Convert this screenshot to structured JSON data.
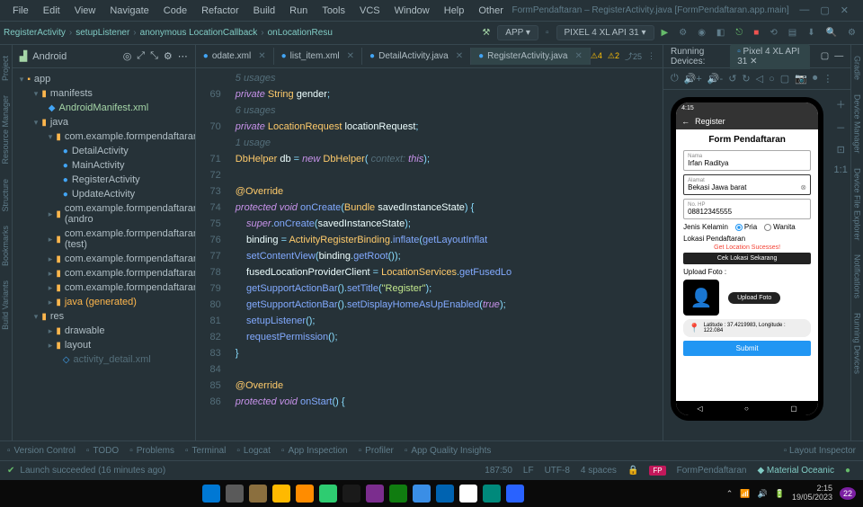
{
  "menu": [
    "File",
    "Edit",
    "View",
    "Navigate",
    "Code",
    "Refactor",
    "Build",
    "Run",
    "Tools",
    "VCS",
    "Window",
    "Help",
    "Other"
  ],
  "window_title": "FormPendaftaran – RegisterActivity.java [FormPendaftaran.app.main]",
  "breadcrumb": [
    "RegisterActivity",
    "setupListener",
    "anonymous LocationCallback",
    "onLocationResu"
  ],
  "run_config": "APP",
  "device_combo": "PIXEL 4 XL API 31",
  "project_label": "Android",
  "tree": {
    "app": "app",
    "manifests": "manifests",
    "manifest_file": "AndroidManifest.xml",
    "java": "java",
    "pkg": "com.example.formpendaftaran",
    "files": [
      "DetailActivity",
      "MainActivity",
      "RegisterActivity",
      "UpdateActivity"
    ],
    "other_pkgs": [
      "com.example.formpendaftaran (andro",
      "com.example.formpendaftaran (test)",
      "com.example.formpendaftaran.adapto",
      "com.example.formpendaftaran.db",
      "com.example.formpendaftaran.model"
    ],
    "gen": "java (generated)",
    "res": "res",
    "res_sub": [
      "drawable",
      "layout"
    ],
    "res_trunc": "activity_detail.xml"
  },
  "tabs": [
    {
      "label": "odate.xml",
      "active": false
    },
    {
      "label": "list_item.xml",
      "active": false
    },
    {
      "label": "DetailActivity.java",
      "active": false
    },
    {
      "label": "RegisterActivity.java",
      "active": true
    }
  ],
  "indicators": {
    "w1": "4",
    "w2": "2",
    "e": "25"
  },
  "code": {
    "start": 69,
    "lines": [
      {
        "t": "usage",
        "txt": "5 usages"
      },
      {
        "t": "code",
        "frags": [
          [
            "kw",
            "private"
          ],
          [
            "op",
            " "
          ],
          [
            "ty",
            "String"
          ],
          [
            "op",
            " "
          ],
          [
            "id",
            "gender"
          ],
          [
            "op",
            ";"
          ]
        ]
      },
      {
        "t": "usage",
        "txt": "6 usages"
      },
      {
        "t": "code",
        "frags": [
          [
            "kw",
            "private"
          ],
          [
            "op",
            " "
          ],
          [
            "ty",
            "LocationRequest"
          ],
          [
            "op",
            " "
          ],
          [
            "id",
            "locationRequest"
          ],
          [
            "op",
            ";"
          ]
        ]
      },
      {
        "t": "usage",
        "txt": "1 usage"
      },
      {
        "t": "code",
        "frags": [
          [
            "ty",
            "DbHelper"
          ],
          [
            "op",
            " "
          ],
          [
            "id",
            "db"
          ],
          [
            "op",
            " = "
          ],
          [
            "kw",
            "new"
          ],
          [
            "op",
            " "
          ],
          [
            "ty",
            "DbHelper"
          ],
          [
            "op",
            "( "
          ],
          [
            "cm",
            "context: "
          ],
          [
            "kw",
            "this"
          ],
          [
            "op",
            ");"
          ]
        ]
      },
      {
        "t": "blank"
      },
      {
        "t": "code",
        "frags": [
          [
            "an",
            "@Override"
          ]
        ]
      },
      {
        "t": "code",
        "frags": [
          [
            "kw",
            "protected"
          ],
          [
            "op",
            " "
          ],
          [
            "kw",
            "void"
          ],
          [
            "op",
            " "
          ],
          [
            "fn",
            "onCreate"
          ],
          [
            "op",
            "("
          ],
          [
            "ty",
            "Bundle"
          ],
          [
            "op",
            " "
          ],
          [
            "id",
            "savedInstanceState"
          ],
          [
            "op",
            ") {"
          ]
        ]
      },
      {
        "t": "code",
        "indent": 1,
        "frags": [
          [
            "kw",
            "super"
          ],
          [
            "op",
            "."
          ],
          [
            "fn",
            "onCreate"
          ],
          [
            "op",
            "("
          ],
          [
            "id",
            "savedInstanceState"
          ],
          [
            "op",
            ");"
          ]
        ]
      },
      {
        "t": "code",
        "indent": 1,
        "frags": [
          [
            "id",
            "binding"
          ],
          [
            "op",
            " = "
          ],
          [
            "ty",
            "ActivityRegisterBinding"
          ],
          [
            "op",
            "."
          ],
          [
            "fn",
            "inflate"
          ],
          [
            "op",
            "("
          ],
          [
            "fn",
            "getLayoutInflat"
          ]
        ]
      },
      {
        "t": "code",
        "indent": 1,
        "frags": [
          [
            "fn",
            "setContentView"
          ],
          [
            "op",
            "("
          ],
          [
            "id",
            "binding"
          ],
          [
            "op",
            "."
          ],
          [
            "fn",
            "getRoot"
          ],
          [
            "op",
            "());"
          ]
        ]
      },
      {
        "t": "code",
        "indent": 1,
        "frags": [
          [
            "id",
            "fusedLocationProviderClient"
          ],
          [
            "op",
            " = "
          ],
          [
            "ty",
            "LocationServices"
          ],
          [
            "op",
            "."
          ],
          [
            "fn",
            "getFusedLo"
          ]
        ]
      },
      {
        "t": "code",
        "indent": 1,
        "frags": [
          [
            "fn",
            "getSupportActionBar"
          ],
          [
            "op",
            "()."
          ],
          [
            "fn",
            "setTitle"
          ],
          [
            "op",
            "("
          ],
          [
            "str",
            "\"Register\""
          ],
          [
            "op",
            ");"
          ]
        ]
      },
      {
        "t": "code",
        "indent": 1,
        "frags": [
          [
            "fn",
            "getSupportActionBar"
          ],
          [
            "op",
            "()."
          ],
          [
            "fn",
            "setDisplayHomeAsUpEnabled"
          ],
          [
            "op",
            "("
          ],
          [
            "kw",
            "true"
          ],
          [
            "op",
            ");"
          ]
        ]
      },
      {
        "t": "code",
        "indent": 1,
        "frags": [
          [
            "fn",
            "setupListener"
          ],
          [
            "op",
            "();"
          ]
        ]
      },
      {
        "t": "code",
        "indent": 1,
        "frags": [
          [
            "fn",
            "requestPermission"
          ],
          [
            "op",
            "();"
          ]
        ]
      },
      {
        "t": "code",
        "frags": [
          [
            "op",
            "}"
          ]
        ]
      },
      {
        "t": "blank"
      },
      {
        "t": "code",
        "frags": [
          [
            "an",
            "@Override"
          ]
        ]
      },
      {
        "t": "code",
        "frags": [
          [
            "kw",
            "protected"
          ],
          [
            "op",
            " "
          ],
          [
            "kw",
            "void"
          ],
          [
            "op",
            " "
          ],
          [
            "fn",
            "onStart"
          ],
          [
            "op",
            "() {"
          ]
        ]
      }
    ]
  },
  "running_label": "Running Devices:",
  "running_tab": "Pixel 4 XL API 31",
  "phone": {
    "time": "4:15",
    "title": "Register",
    "form_title": "Form Pendaftaran",
    "nama_lbl": "Nama",
    "nama_val": "Irfan Raditya",
    "alamat_lbl": "Alamat",
    "alamat_val": "Bekasi Jawa barat",
    "hp_lbl": "No. HP",
    "hp_val": "08812345555",
    "jk": "Jenis Kelamin",
    "pria": "Pria",
    "wanita": "Wanita",
    "lokasi": "Lokasi Pendaftaran",
    "lokasi_link": "Get Location Sucesses!",
    "cek": "Cek Lokasi Sekarang",
    "upload_lbl": "Upload Foto :",
    "upload_btn": "Upload Foto",
    "loc_text": "Latitude : 37.4219983, Longitude : 122.084",
    "submit": "Submit"
  },
  "bottom": [
    "Version Control",
    "TODO",
    "Problems",
    "Terminal",
    "Logcat",
    "App Inspection",
    "Profiler",
    "App Quality Insights"
  ],
  "bottom_right": "Layout Inspector",
  "status": {
    "msg": "Launch succeeded (16 minutes ago)",
    "pos": "187:50",
    "le": "LF",
    "enc": "UTF-8",
    "ind": "4 spaces",
    "badge": "FP",
    "proj": "FormPendaftaran",
    "theme": "Material Oceanic"
  },
  "tray": {
    "time": "2:15",
    "date": "19/05/2023",
    "count": "22"
  },
  "sidebars": {
    "left": [
      "Project",
      "Resource Manager",
      "Structure",
      "Bookmarks",
      "Build Variants"
    ],
    "right": [
      "Gradle",
      "Device Manager",
      "Device File Explorer",
      "Notifications",
      "Running Devices"
    ]
  }
}
